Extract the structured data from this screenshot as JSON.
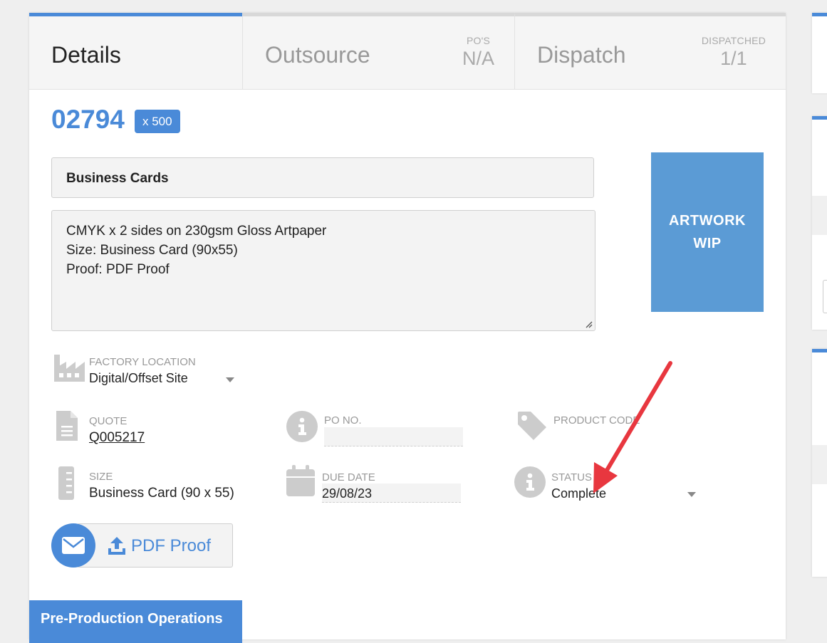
{
  "tabs": [
    {
      "label": "Details"
    },
    {
      "label": "Outsource",
      "count_label": "PO'S",
      "count_value": "N/A"
    },
    {
      "label": "Dispatch",
      "count_label": "DISPATCHED",
      "count_value": "1/1"
    }
  ],
  "job": {
    "number": "02794",
    "quantity": "x 500",
    "title": "Business Cards",
    "description": "CMYK x 2 sides on 230gsm Gloss Artpaper\nSize: Business Card (90x55)\nProof: PDF Proof"
  },
  "artwork": {
    "label": "ARTWORK\nWIP"
  },
  "fields": {
    "factory_location": {
      "label": "FACTORY LOCATION",
      "value": "Digital/Offset Site"
    },
    "quote": {
      "label": "QUOTE",
      "value": "Q005217"
    },
    "po_no": {
      "label": "PO NO.",
      "value": ""
    },
    "product_code": {
      "label": "PRODUCT CODE",
      "value": ""
    },
    "size": {
      "label": "SIZE",
      "value": "Business Card (90 x 55)"
    },
    "due_date": {
      "label": "DUE DATE",
      "value": "29/08/23"
    },
    "status": {
      "label": "STATUS",
      "value": "Complete"
    }
  },
  "proof_button": {
    "label": "PDF Proof"
  },
  "section": {
    "label": "Pre-Production Operations"
  },
  "colors": {
    "accent": "#4a8ad8",
    "artwork": "#5b9bd5",
    "annotation_arrow": "#e8373f"
  },
  "icons": [
    "factory-icon",
    "document-icon",
    "info-icon",
    "tag-icon",
    "ruler-icon",
    "calendar-icon",
    "envelope-icon",
    "upload-icon",
    "caret-down-icon"
  ]
}
